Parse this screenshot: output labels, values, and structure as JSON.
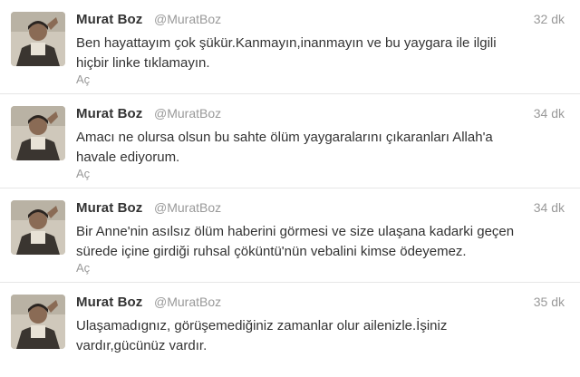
{
  "tweets": [
    {
      "name": "Murat Boz",
      "handle": "@MuratBoz",
      "time": "32 dk",
      "text": "Ben hayattayım çok şükür.Kanmayın,inanmayın ve bu yaygara ile ilgili hiçbir linke tıklamayın.",
      "expand": "Aç"
    },
    {
      "name": "Murat Boz",
      "handle": "@MuratBoz",
      "time": "34 dk",
      "text": "Amacı ne olursa olsun bu sahte ölüm yaygaralarını çıkaranları Allah'a havale ediyorum.",
      "expand": "Aç"
    },
    {
      "name": "Murat Boz",
      "handle": "@MuratBoz",
      "time": "34 dk",
      "text": "Bir Anne'nin asılsız ölüm haberini görmesi ve size ulaşana kadarki geçen sürede içine girdiği ruhsal çöküntü'nün vebalini kimse ödeyemez.",
      "expand": "Aç"
    },
    {
      "name": "Murat Boz",
      "handle": "@MuratBoz",
      "time": "35 dk",
      "text": "Ulaşamadıgnız, görüşemediğiniz zamanlar olur ailenizle.İşiniz vardır,gücünüz vardır.",
      "expand": ""
    }
  ]
}
